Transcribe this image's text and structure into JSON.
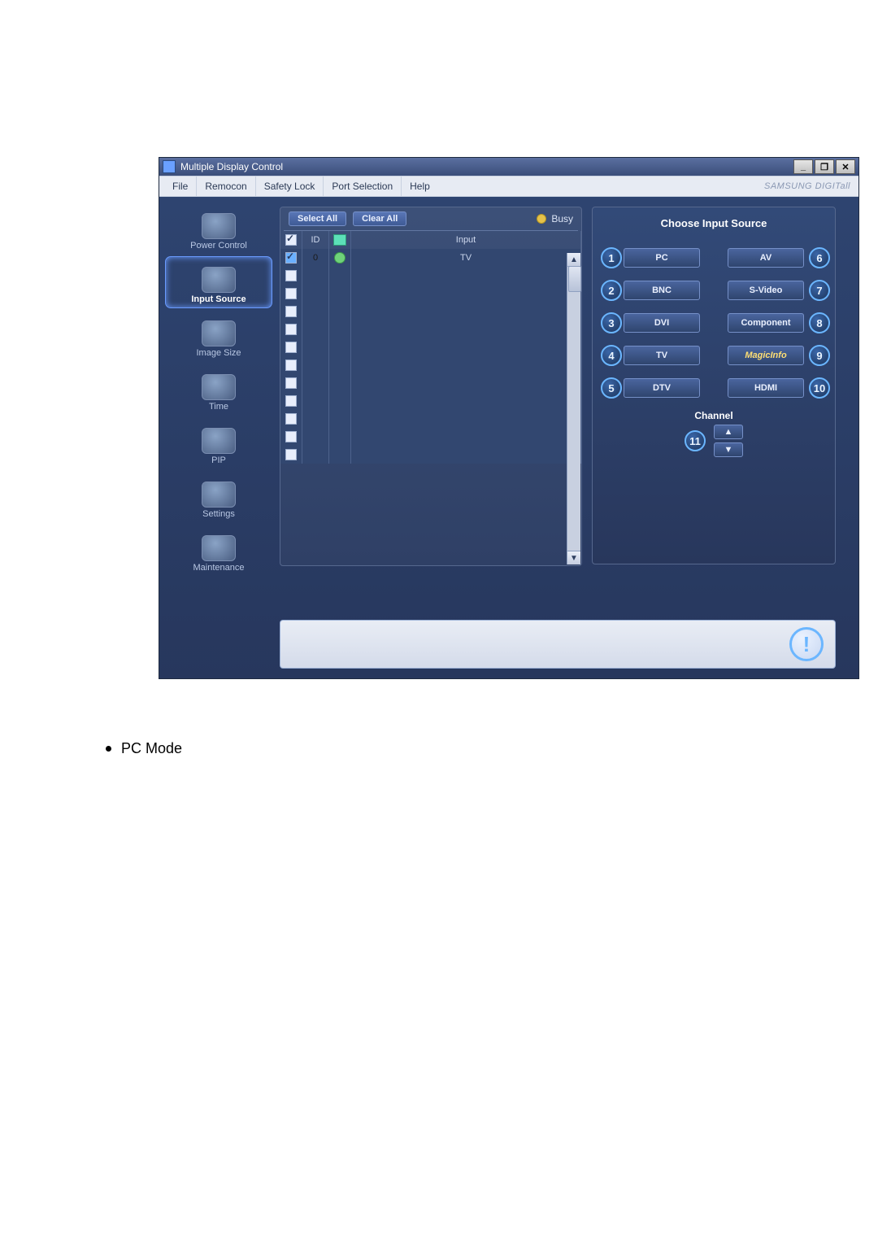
{
  "caption": "PC Mode",
  "window": {
    "title": "Multiple Display Control",
    "brand": "SAMSUNG DIGITall",
    "win_buttons": {
      "min": "_",
      "restore": "❐",
      "close": "✕"
    }
  },
  "menubar": [
    "File",
    "Remocon",
    "Safety Lock",
    "Port Selection",
    "Help"
  ],
  "sidebar": [
    {
      "label": "Power Control",
      "selected": false
    },
    {
      "label": "Input Source",
      "selected": true
    },
    {
      "label": "Image Size",
      "selected": false
    },
    {
      "label": "Time",
      "selected": false
    },
    {
      "label": "PIP",
      "selected": false
    },
    {
      "label": "Settings",
      "selected": false
    },
    {
      "label": "Maintenance",
      "selected": false
    }
  ],
  "toolbar": {
    "select_all": "Select All",
    "clear_all": "Clear All",
    "busy_label": "Busy"
  },
  "grid": {
    "columns": {
      "id": "ID",
      "input": "Input"
    },
    "rows": [
      {
        "checked": true,
        "id": "0",
        "status": true,
        "input": "TV"
      },
      {
        "checked": false,
        "id": "",
        "status": false,
        "input": ""
      },
      {
        "checked": false,
        "id": "",
        "status": false,
        "input": ""
      },
      {
        "checked": false,
        "id": "",
        "status": false,
        "input": ""
      },
      {
        "checked": false,
        "id": "",
        "status": false,
        "input": ""
      },
      {
        "checked": false,
        "id": "",
        "status": false,
        "input": ""
      },
      {
        "checked": false,
        "id": "",
        "status": false,
        "input": ""
      },
      {
        "checked": false,
        "id": "",
        "status": false,
        "input": ""
      },
      {
        "checked": false,
        "id": "",
        "status": false,
        "input": ""
      },
      {
        "checked": false,
        "id": "",
        "status": false,
        "input": ""
      },
      {
        "checked": false,
        "id": "",
        "status": false,
        "input": ""
      },
      {
        "checked": false,
        "id": "",
        "status": false,
        "input": ""
      }
    ]
  },
  "right_panel": {
    "title": "Choose Input Source",
    "sources_left": [
      "PC",
      "BNC",
      "DVI",
      "TV",
      "DTV"
    ],
    "sources_right": [
      "AV",
      "S-Video",
      "Component",
      "MagicInfo",
      "HDMI"
    ],
    "numbers_left": [
      "1",
      "2",
      "3",
      "4",
      "5"
    ],
    "numbers_right": [
      "6",
      "7",
      "8",
      "9",
      "10"
    ],
    "channel_label": "Channel",
    "channel_badge": "11",
    "ch_up": "▲",
    "ch_down": "▼"
  }
}
